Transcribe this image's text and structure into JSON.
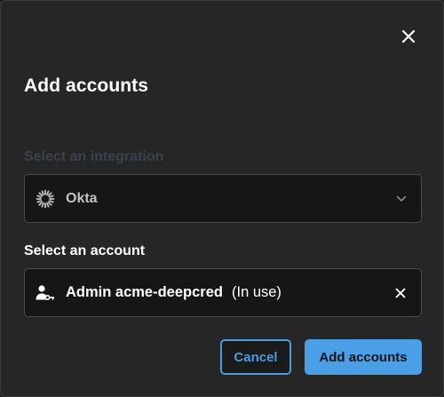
{
  "dialog": {
    "title": "Add accounts",
    "close_icon": "close-icon"
  },
  "integration": {
    "label": "Select an integration",
    "selected_value": "Okta",
    "icon": "okta-icon",
    "dropdown_icon": "chevron-down-icon"
  },
  "account": {
    "label": "Select an account",
    "name": "Admin acme-deepcred",
    "status": "(In use)",
    "icon": "user-key-icon",
    "clear_icon": "close-icon"
  },
  "actions": {
    "cancel_label": "Cancel",
    "submit_label": "Add accounts"
  },
  "colors": {
    "background": "#262626",
    "field_background": "#161616",
    "accent": "#4b9fe6",
    "muted_label": "#3c4150"
  }
}
